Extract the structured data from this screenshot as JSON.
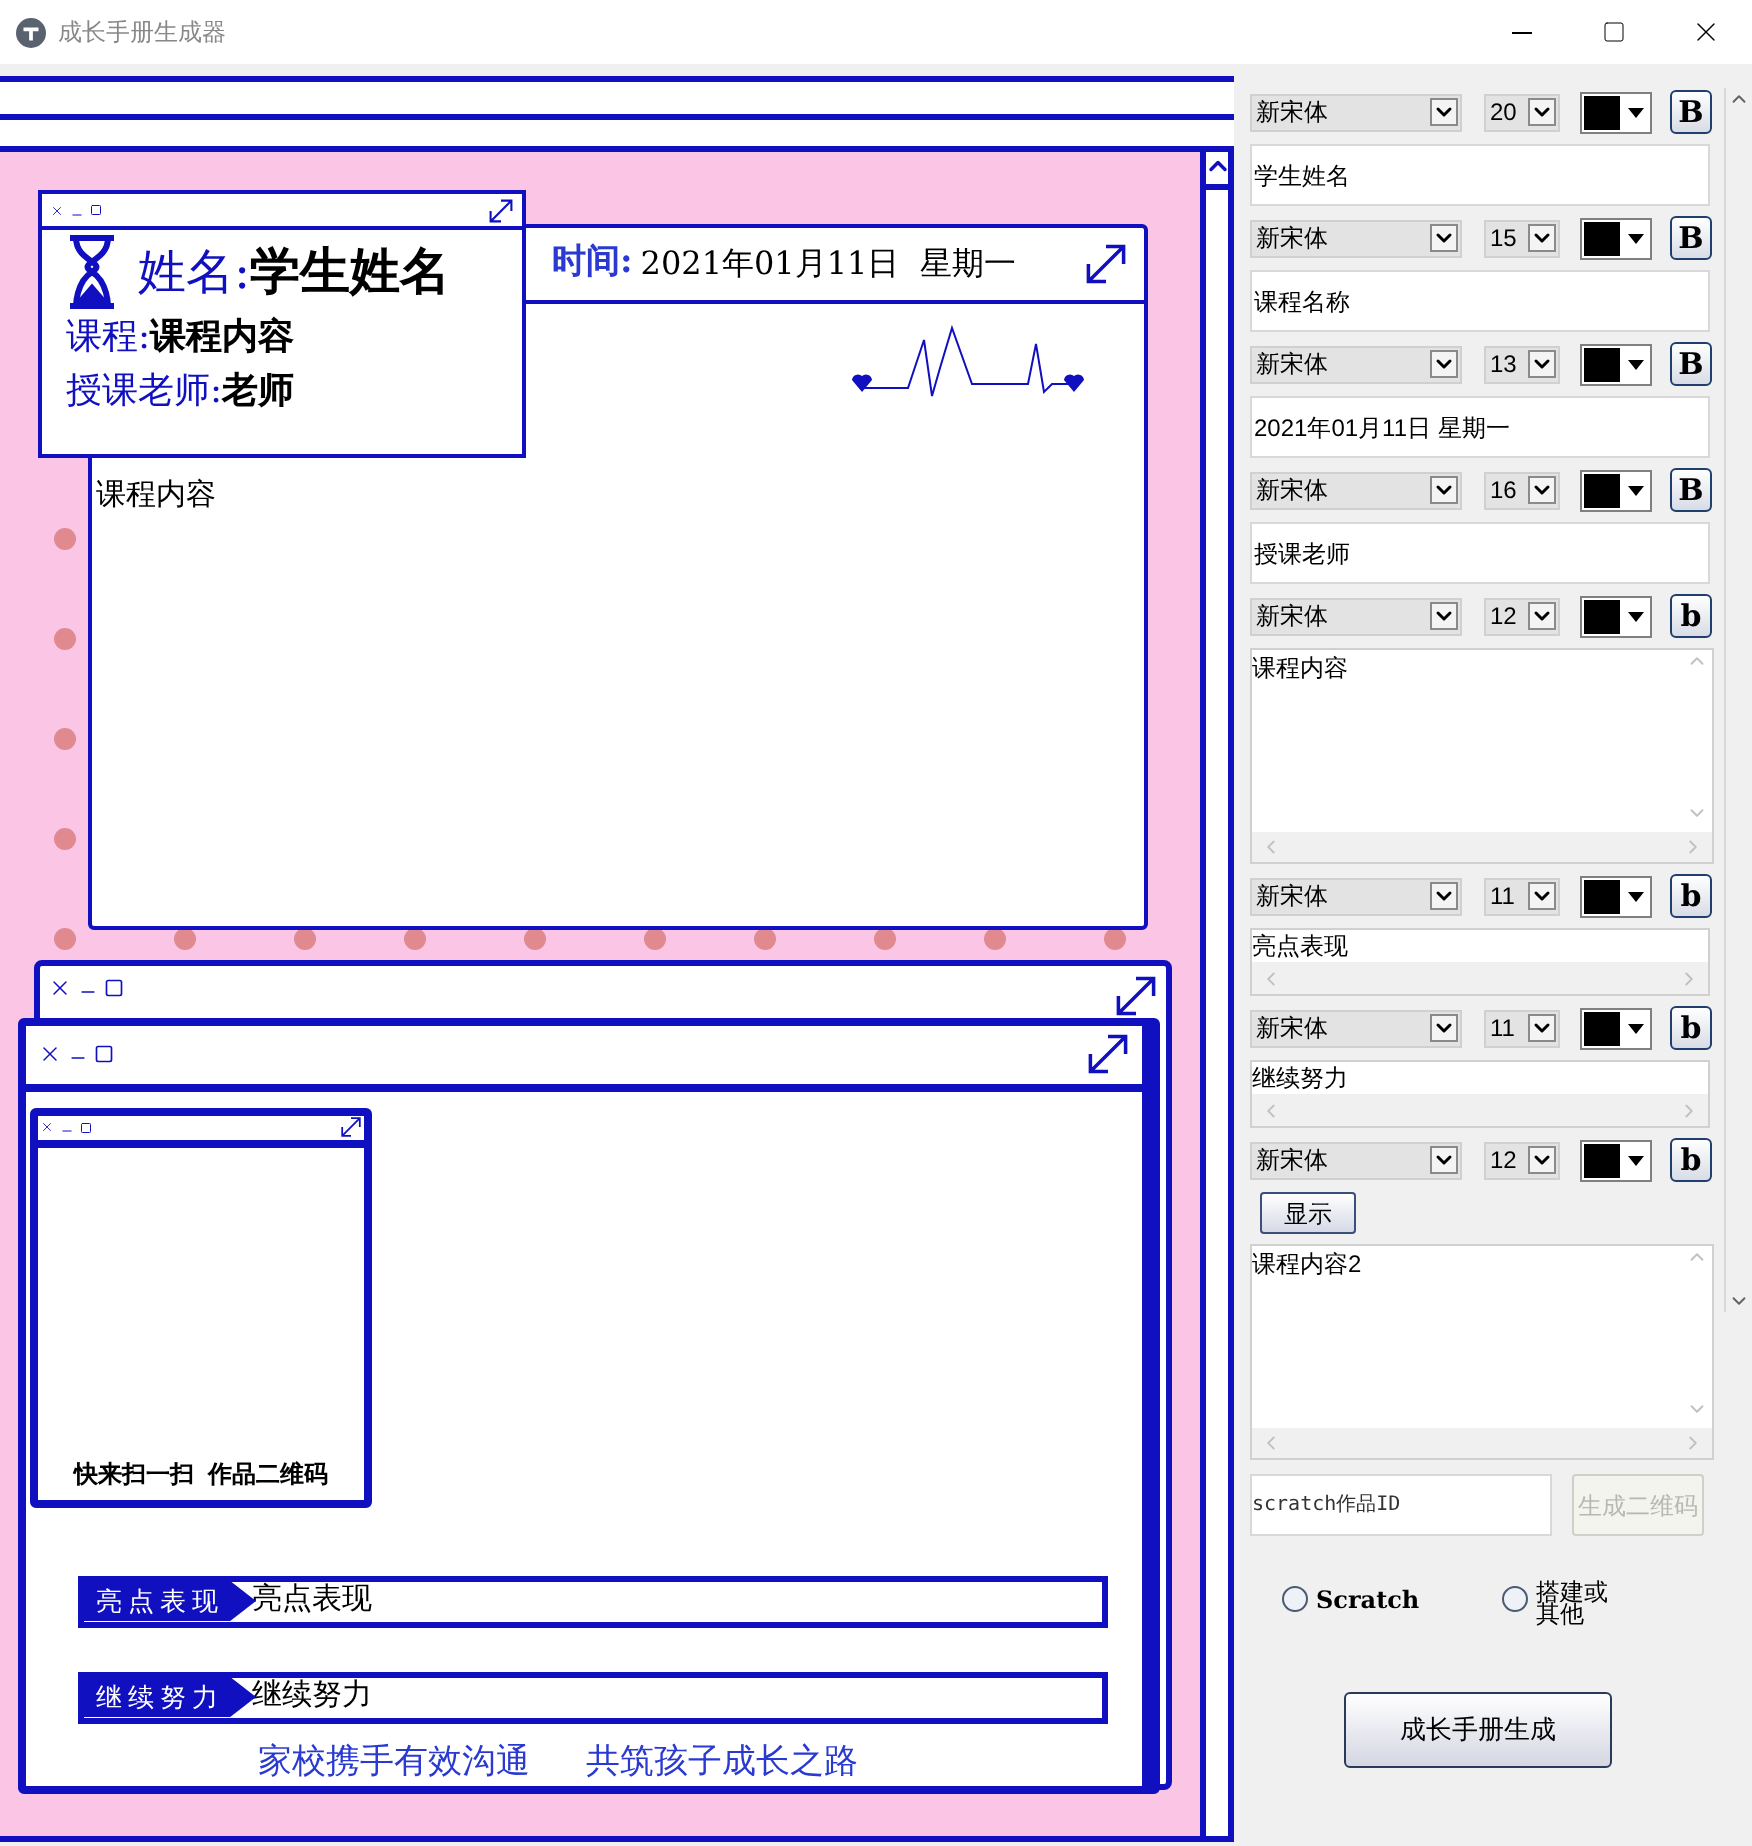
{
  "window": {
    "title": "成长手册生成器"
  },
  "preview": {
    "header_card": {
      "name_label": "姓名:",
      "name_value": "学生姓名",
      "course_label": "课程:",
      "course_value": "课程内容",
      "teacher_label": "授课老师:",
      "teacher_value": "老师"
    },
    "time_bar": {
      "label": "时间:",
      "value": "2021年01月11日  星期一"
    },
    "content_text": "课程内容",
    "qr_card": {
      "caption": "快来扫一扫  作品二维码"
    },
    "feedback": [
      {
        "tag": "亮点表现",
        "value": "亮点表现"
      },
      {
        "tag": "继续努力",
        "value": "继续努力"
      }
    ],
    "slogan": [
      "家校携手有效沟通",
      "共筑孩子成长之路"
    ]
  },
  "style_rows": [
    {
      "font": "新宋体",
      "size": "20",
      "bold": "B",
      "field": {
        "kind": "input",
        "value": "学生姓名"
      }
    },
    {
      "font": "新宋体",
      "size": "15",
      "bold": "B",
      "field": {
        "kind": "input",
        "value": "课程名称"
      }
    },
    {
      "font": "新宋体",
      "size": "13",
      "bold": "B",
      "field": {
        "kind": "input",
        "value": "2021年01月11日 星期一"
      }
    },
    {
      "font": "新宋体",
      "size": "16",
      "bold": "B",
      "field": {
        "kind": "input",
        "value": "授课老师"
      }
    },
    {
      "font": "新宋体",
      "size": "12",
      "bold": "b",
      "field": {
        "kind": "textarea",
        "value": "课程内容"
      }
    },
    {
      "font": "新宋体",
      "size": "11",
      "bold": "b",
      "field": {
        "kind": "scrollline",
        "value": "亮点表现"
      }
    },
    {
      "font": "新宋体",
      "size": "11",
      "bold": "b",
      "field": {
        "kind": "scrollline",
        "value": "继续努力"
      }
    },
    {
      "font": "新宋体",
      "size": "12",
      "bold": "b",
      "action": "显示",
      "field": {
        "kind": "textarea",
        "value": "课程内容2"
      }
    }
  ],
  "work_id": {
    "value": "scratch作品ID",
    "button": "生成二维码",
    "button_disabled": true
  },
  "work_type": [
    {
      "label": "Scratch",
      "selected": false
    },
    {
      "label": "搭建或其他",
      "selected": false
    }
  ],
  "generate_button": "成长手册生成"
}
